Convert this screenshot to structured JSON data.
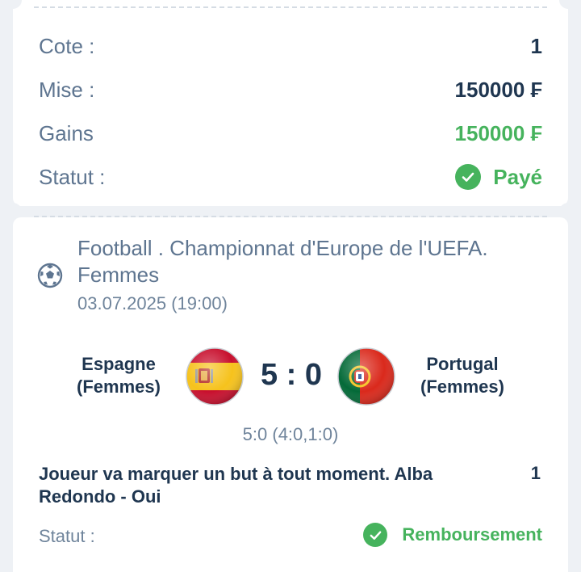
{
  "summary": {
    "rows": [
      {
        "label": "Cote :",
        "value": "1"
      },
      {
        "label": "Mise :",
        "value": "150000 ₣"
      },
      {
        "label": "Gains",
        "value": "150000 ₣"
      },
      {
        "label": "Statut :",
        "value": "Payé"
      }
    ]
  },
  "event": {
    "league": "Football . Championnat d'Europe de l'UEFA. Femmes",
    "date": "03.07.2025 (19:00)",
    "home_team": "Espagne (Femmes)",
    "away_team": "Portugal (Femmes)",
    "score": "5 : 0",
    "sub_score": "5:0 (4:0,1:0)",
    "market": "Joueur va marquer un but à tout moment. Alba Redondo - Oui",
    "market_odd": "1",
    "status_label": "Statut :",
    "status_value": "Remboursement"
  },
  "colors": {
    "success": "#46b35d",
    "label": "#5e7590",
    "text": "#1f3650"
  },
  "icons": [
    "check-circle-icon",
    "football-icon",
    "spain-flag-icon",
    "portugal-flag-icon"
  ]
}
